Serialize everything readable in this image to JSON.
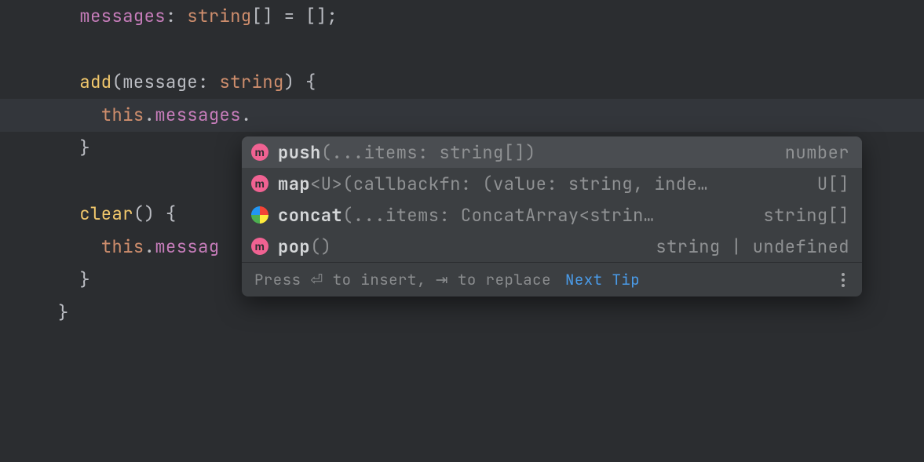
{
  "code": {
    "line1": {
      "field": "messages",
      "colon": ": ",
      "type": "string",
      "brackets": "[]",
      "eq": " = ",
      "val": "[]",
      "semi": ";"
    },
    "line3": {
      "fn": "add",
      "open": "(",
      "param": "message",
      "colon": ": ",
      "type": "string",
      "close": ") ",
      "brace": "{"
    },
    "line4": {
      "indent": "    ",
      "this": "this",
      "dot1": ".",
      "prop": "messages",
      "dot2": "."
    },
    "line5": {
      "brace": "}"
    },
    "line7": {
      "fn": "clear",
      "parens": "() ",
      "brace": "{"
    },
    "line8": {
      "indent": "    ",
      "this": "this",
      "dot": ".",
      "prop": "messag"
    },
    "line9": {
      "brace": "}"
    },
    "line10": {
      "brace": "}"
    }
  },
  "popup": {
    "items": [
      {
        "icon": "m",
        "name": "push",
        "sig": "(...items: string[])",
        "ret": "number"
      },
      {
        "icon": "m",
        "name": "map",
        "sig": "<U>(callbackfn: (value: string, inde…",
        "ret": "U[]"
      },
      {
        "icon": "turbo",
        "name": "concat",
        "sig": "(...items: ConcatArray<strin…",
        "ret": "string[]"
      },
      {
        "icon": "m",
        "name": "pop",
        "sig": "()",
        "ret": "string | undefined"
      }
    ],
    "footer": {
      "hint_pre": "Press ",
      "enter": "⏎",
      "hint_mid": " to insert, ",
      "tab": "⇥",
      "hint_post": " to replace",
      "next_tip": "Next Tip"
    }
  }
}
